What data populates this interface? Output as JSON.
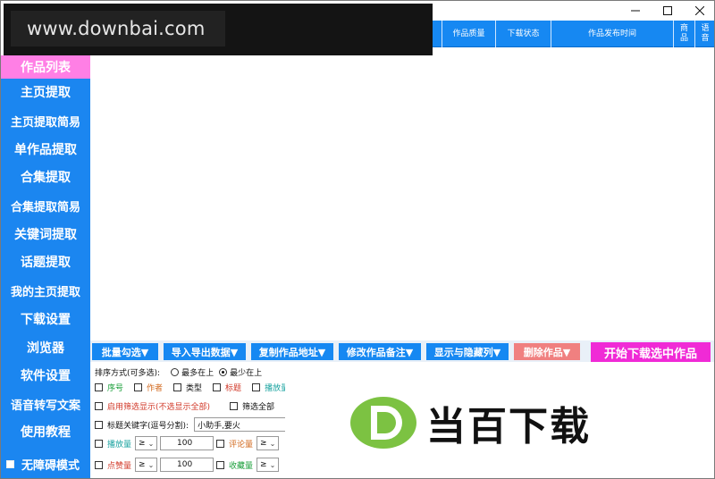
{
  "watermark": {
    "site": "www.downbai.com"
  },
  "window": {
    "controls": [
      "minimize",
      "maximize",
      "close"
    ]
  },
  "grid": {
    "columns": [
      "作品质量",
      "下载状态",
      "作品发布时间",
      "商品",
      "语音"
    ]
  },
  "sidebar": {
    "items": [
      {
        "label": "作品列表",
        "active": true
      },
      {
        "label": "主页提取"
      },
      {
        "label": "主页提取简易"
      },
      {
        "label": "单作品提取"
      },
      {
        "label": "合集提取"
      },
      {
        "label": "合集提取简易"
      },
      {
        "label": "关键词提取"
      },
      {
        "label": "话题提取"
      },
      {
        "label": "我的主页提取"
      },
      {
        "label": "下载设置"
      },
      {
        "label": "浏览器"
      },
      {
        "label": "软件设置"
      },
      {
        "label": "语音转写文案"
      },
      {
        "label": "使用教程"
      }
    ],
    "accessible_mode": "无障碍模式"
  },
  "toolbar": {
    "batch_select": "批量勾选▼",
    "import_export": "导入导出数据▼",
    "copy_address": "复制作品地址▼",
    "edit_note": "修改作品备注▼",
    "show_hide_cols": "显示与隐藏列▼",
    "delete": "删除作品▼",
    "start_download": "开始下载选中作品"
  },
  "filters": {
    "sort_label": "排序方式(可多选):",
    "sort_most": "最多在上",
    "sort_least": "最少在上",
    "columns": [
      "序号",
      "作者",
      "类型",
      "标题",
      "播放量"
    ],
    "enable_filter": "启用筛选显示(不选显示全部)",
    "filter_all": "筛选全部",
    "title_keywords_label": "标题关键字(逗号分割):",
    "title_keywords_value": "小助手,要火",
    "play_count": "播放量",
    "comment_count": "评论量",
    "like_count": "点赞量",
    "collect_count": "收藏量",
    "operator": "≥",
    "threshold_1": "100",
    "threshold_2": "100"
  },
  "brand": {
    "name": "当百下载",
    "logo_letter": "D"
  },
  "colors": {
    "primary": "#1688f2",
    "active_nav": "#ff7fe5",
    "download_btn": "#f02ad6",
    "delete_btn": "#f08080"
  }
}
